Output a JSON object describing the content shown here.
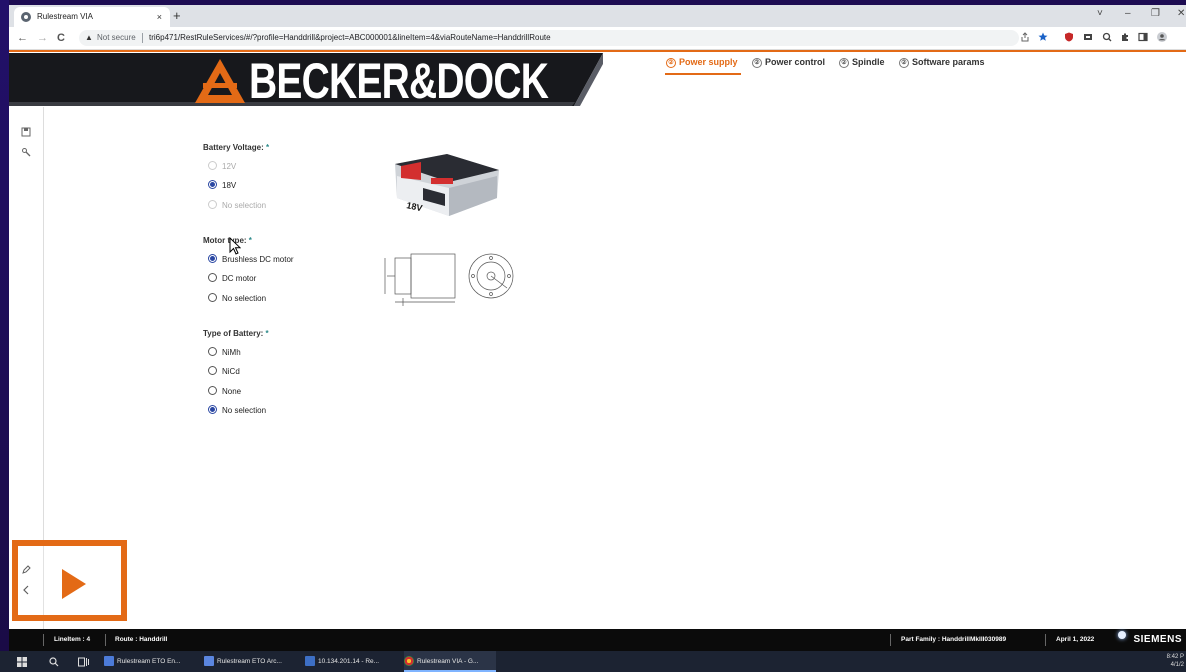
{
  "browser": {
    "tab_title": "Rulestream VIA",
    "tab_close": "×",
    "new_tab": "+",
    "security_label": "Not secure",
    "url": "tri6p471/RestRuleServices/#/?profile=Handdrill&project=ABC000001&lineItem=4&viaRouteName=HanddrillRoute",
    "back": "←",
    "forward": "→",
    "reload": "C",
    "window_controls": [
      "˅",
      "–",
      "❐",
      "✕"
    ]
  },
  "header": {
    "logo_text": "BECKER&DOCK",
    "steps": [
      {
        "number": "②",
        "label": "Power supply",
        "active": true
      },
      {
        "number": "②",
        "label": "Power control",
        "active": false
      },
      {
        "number": "②",
        "label": "Spindle",
        "active": false
      },
      {
        "number": "②",
        "label": "Software params",
        "active": false
      }
    ]
  },
  "form": {
    "battery_voltage": {
      "label": "Battery Voltage:",
      "required_mark": "*",
      "options": [
        {
          "label": "12V",
          "checked": false,
          "disabled": true
        },
        {
          "label": "18V",
          "checked": true,
          "disabled": false
        },
        {
          "label": "No selection",
          "checked": false,
          "disabled": true
        }
      ]
    },
    "motor_type": {
      "label": "Motor type:",
      "required_mark": "*",
      "options": [
        {
          "label": "Brushless DC motor",
          "checked": true,
          "disabled": false
        },
        {
          "label": "DC motor",
          "checked": false,
          "disabled": false
        },
        {
          "label": "No selection",
          "checked": false,
          "disabled": false
        }
      ]
    },
    "battery_type": {
      "label": "Type of Battery:",
      "required_mark": "*",
      "options": [
        {
          "label": "NiMh",
          "checked": false,
          "disabled": false
        },
        {
          "label": "NiCd",
          "checked": false,
          "disabled": false
        },
        {
          "label": "None",
          "checked": false,
          "disabled": false
        },
        {
          "label": "No selection",
          "checked": true,
          "disabled": false
        }
      ]
    },
    "battery_image_text": "18V"
  },
  "status_bar": {
    "line_item": "LineItem : 4",
    "route": "Route : Handdrill",
    "part_family": "Part Family : HanddrillMkIII030989",
    "date": "April 1, 2022",
    "brand": "SIEMENS"
  },
  "taskbar": {
    "items": [
      {
        "label": "Rulestream ETO En...",
        "active": false
      },
      {
        "label": "Rulestream ETO Arc...",
        "active": false
      },
      {
        "label": "10.134.201.14 - Re...",
        "active": false
      },
      {
        "label": "Rulestream VIA - G...",
        "active": true
      }
    ],
    "clock_time": "8:42 P",
    "clock_date": "4/1/2"
  },
  "colors": {
    "accent": "#e36a16",
    "radio_checked": "#2a47a3",
    "required": "#2c8a8a"
  }
}
